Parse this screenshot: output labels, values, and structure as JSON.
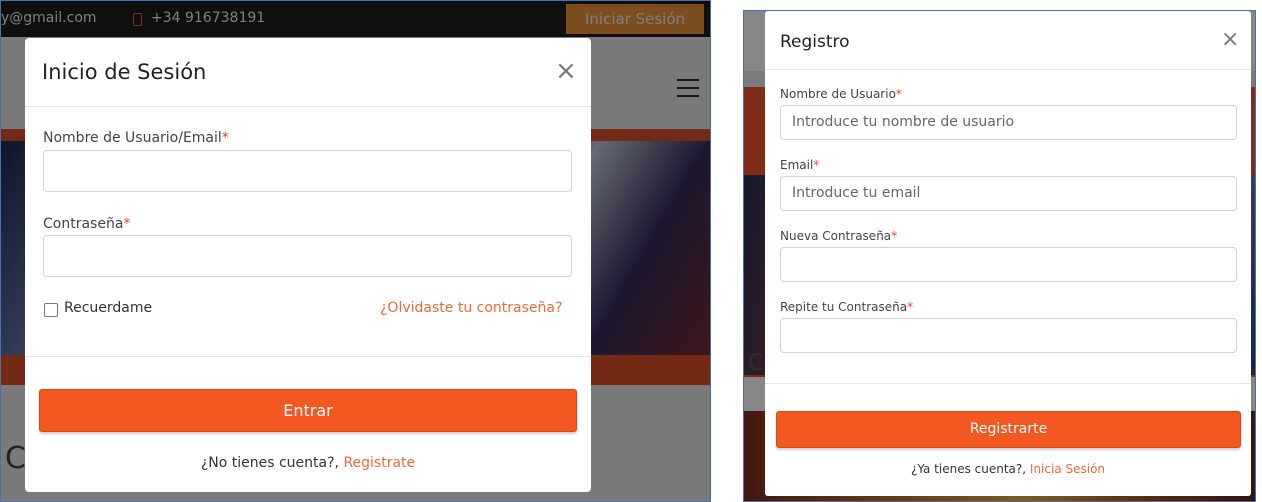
{
  "background_page": {
    "email_partial": "y@gmail.com",
    "phone": "+34 916738191",
    "login_button": "Iniciar Sesión",
    "partial_letter_left": "C",
    "partial_letter_right": "C"
  },
  "login_modal": {
    "title": "Inicio de Sesión",
    "close_icon": "×",
    "username_label": "Nombre de Usuario/Email",
    "password_label": "Contraseña",
    "required_mark": "*",
    "remember_label": "Recuerdame",
    "forgot_link": "¿Olvidaste tu contraseña?",
    "submit_label": "Entrar",
    "footer_text": "¿No tienes cuenta?, ",
    "footer_link": "Registrate"
  },
  "register_modal": {
    "title": "Registro",
    "close_icon": "×",
    "required_mark": "*",
    "username_label": "Nombre de Usuario",
    "username_placeholder": "Introduce tu nombre de usuario",
    "email_label": "Email",
    "email_placeholder": "Introduce tu email",
    "new_password_label": "Nueva Contraseña",
    "repeat_password_label": "Repite tu Contraseña",
    "submit_label": "Registrarte",
    "footer_text": "¿Ya tienes cuenta?, ",
    "footer_link": "Inicia Sesión"
  },
  "colors": {
    "accent": "#f2581f",
    "link": "#f2683a",
    "required": "#e8452a"
  }
}
